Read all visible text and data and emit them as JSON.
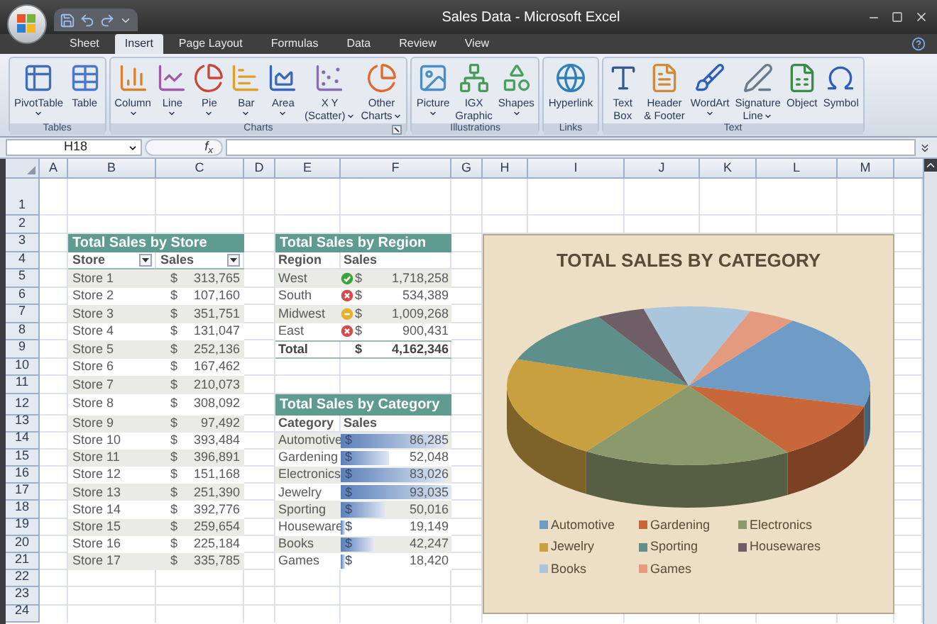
{
  "window": {
    "title": "Sales Data - Microsoft Excel"
  },
  "ribbon": {
    "tabs": [
      {
        "label": "Sheet",
        "selected": false
      },
      {
        "label": "Insert",
        "selected": true
      },
      {
        "label": "Page Layout",
        "selected": false
      },
      {
        "label": "Formulas",
        "selected": false
      },
      {
        "label": "Data",
        "selected": false
      },
      {
        "label": "Review",
        "selected": false
      },
      {
        "label": "View",
        "selected": false
      }
    ],
    "groups": [
      {
        "label": "Tables",
        "launcher": false,
        "buttons": [
          {
            "kind": "pivot",
            "lines": [
              "PivotTable"
            ],
            "dropdown": true
          },
          {
            "kind": "table",
            "lines": [
              "Table"
            ],
            "dropdown": false
          }
        ]
      },
      {
        "label": "Charts",
        "launcher": true,
        "buttons": [
          {
            "kind": "column",
            "lines": [
              "Column"
            ],
            "dropdown": true
          },
          {
            "kind": "line",
            "lines": [
              "Line"
            ],
            "dropdown": true
          },
          {
            "kind": "pie",
            "lines": [
              "Pie"
            ],
            "dropdown": true
          },
          {
            "kind": "bar",
            "lines": [
              "Bar"
            ],
            "dropdown": true
          },
          {
            "kind": "area",
            "lines": [
              "Area"
            ],
            "dropdown": true
          },
          {
            "kind": "scatter",
            "lines": [
              "X Y",
              "(Scatter)"
            ],
            "dropdown": true
          },
          {
            "kind": "other",
            "lines": [
              "Other",
              "Charts"
            ],
            "dropdown": true
          }
        ]
      },
      {
        "label": "Illustrations",
        "launcher": false,
        "buttons": [
          {
            "kind": "picture",
            "lines": [
              "Picture"
            ],
            "dropdown": true
          },
          {
            "kind": "graphic",
            "lines": [
              "IGX",
              "Graphic"
            ],
            "dropdown": false
          },
          {
            "kind": "shapes",
            "lines": [
              "Shapes"
            ],
            "dropdown": true
          }
        ]
      },
      {
        "label": "Links",
        "launcher": false,
        "buttons": [
          {
            "kind": "hyperlink",
            "lines": [
              "Hyperlink"
            ],
            "dropdown": false
          }
        ]
      },
      {
        "label": "Text",
        "launcher": false,
        "buttons": [
          {
            "kind": "textbox",
            "lines": [
              "Text",
              "Box"
            ],
            "dropdown": false
          },
          {
            "kind": "header",
            "lines": [
              "Header",
              "& Footer"
            ],
            "dropdown": false
          },
          {
            "kind": "wordart",
            "lines": [
              "WordArt"
            ],
            "dropdown": true
          },
          {
            "kind": "signature",
            "lines": [
              "Signature",
              "Line"
            ],
            "dropdown": true
          },
          {
            "kind": "object",
            "lines": [
              "Object"
            ],
            "dropdown": false
          },
          {
            "kind": "symbol",
            "lines": [
              "Symbol"
            ],
            "dropdown": false
          }
        ]
      }
    ]
  },
  "formula_bar": {
    "name_box": "H18",
    "function_label": "f$_{x}$"
  },
  "sheet": {
    "columns": [
      "A",
      "B",
      "C",
      "D",
      "E",
      "F",
      "G",
      "H",
      "I",
      "J",
      "K",
      "L",
      "M"
    ],
    "rows": [
      "1",
      "2",
      "3",
      "4",
      "5",
      "6",
      "7",
      "8",
      "9",
      "10",
      "11",
      "12",
      "13",
      "14",
      "15",
      "16",
      "17",
      "18",
      "19",
      "20",
      "21",
      "22",
      "23",
      "24"
    ]
  },
  "store_table": {
    "title": "Total Sales by Store",
    "headers": [
      "Store",
      "Sales"
    ],
    "rows": [
      {
        "store": "Store 1",
        "currency": "$",
        "sales": "313,765"
      },
      {
        "store": "Store 2",
        "currency": "$",
        "sales": "107,160"
      },
      {
        "store": "Store 3",
        "currency": "$",
        "sales": "351,751"
      },
      {
        "store": "Store 4",
        "currency": "$",
        "sales": "131,047"
      },
      {
        "store": "Store 5",
        "currency": "$",
        "sales": "252,136"
      },
      {
        "store": "Store 6",
        "currency": "$",
        "sales": "167,462"
      },
      {
        "store": "Store 7",
        "currency": "$",
        "sales": "210,073"
      },
      {
        "store": "Store 8",
        "currency": "$",
        "sales": "308,092"
      },
      {
        "store": "Store 9",
        "currency": "$",
        "sales": "97,492"
      },
      {
        "store": "Store 10",
        "currency": "$",
        "sales": "393,484"
      },
      {
        "store": "Store 11",
        "currency": "$",
        "sales": "396,891"
      },
      {
        "store": "Store 12",
        "currency": "$",
        "sales": "151,168"
      },
      {
        "store": "Store 13",
        "currency": "$",
        "sales": "251,390"
      },
      {
        "store": "Store 14",
        "currency": "$",
        "sales": "392,776"
      },
      {
        "store": "Store 15",
        "currency": "$",
        "sales": "259,654"
      },
      {
        "store": "Store 16",
        "currency": "$",
        "sales": "225,184"
      },
      {
        "store": "Store 17",
        "currency": "$",
        "sales": "335,785"
      }
    ]
  },
  "region_table": {
    "title": "Total Sales by Region",
    "headers": [
      "Region",
      "Sales"
    ],
    "rows": [
      {
        "region": "West",
        "kind": "good",
        "currency": "$",
        "sales": "1,718,258"
      },
      {
        "region": "South",
        "kind": "bad",
        "currency": "$",
        "sales": "534,389"
      },
      {
        "region": "Midwest",
        "kind": "warn",
        "currency": "$",
        "sales": "1,009,268"
      },
      {
        "region": "East",
        "kind": "bad",
        "currency": "$",
        "sales": "900,431"
      }
    ],
    "total": {
      "label": "Total",
      "currency": "$",
      "sales": "4,162,346"
    }
  },
  "category_table": {
    "title": "Total Sales by Category",
    "headers": [
      "Category",
      "Sales"
    ],
    "rows": [
      {
        "category": "Automotive",
        "currency": "$",
        "sales": "86,285",
        "level": 0.95
      },
      {
        "category": "Gardening",
        "currency": "$",
        "sales": "52,048",
        "level": 0.44
      },
      {
        "category": "Electronics",
        "currency": "$",
        "sales": "83,026",
        "level": 0.93
      },
      {
        "category": "Jewelry",
        "currency": "$",
        "sales": "93,035",
        "level": 1
      },
      {
        "category": "Sporting",
        "currency": "$",
        "sales": "50,016",
        "level": 0.4
      },
      {
        "category": "Houseware",
        "currency": "$",
        "sales": "19,149",
        "level": 0.04
      },
      {
        "category": "Books",
        "currency": "$",
        "sales": "42,247",
        "level": 0.3
      },
      {
        "category": "Games",
        "currency": "$",
        "sales": "18,420",
        "level": 0.04
      }
    ]
  },
  "chart": {
    "title": "TOTAL SALES BY CATEGORY",
    "legend": [
      {
        "label": "Automotive",
        "color": "#6f9cc6"
      },
      {
        "label": "Gardening",
        "color": "#c8683a"
      },
      {
        "label": "Electronics",
        "color": "#8b9a6c"
      },
      {
        "label": "Jewelry",
        "color": "#c9a03f"
      },
      {
        "label": "Sporting",
        "color": "#5e8f8b"
      },
      {
        "label": "Housewares",
        "color": "#6e5f66"
      },
      {
        "label": "Books",
        "color": "#a9c6dc"
      },
      {
        "label": "Games",
        "color": "#e39a7e"
      }
    ]
  }
}
